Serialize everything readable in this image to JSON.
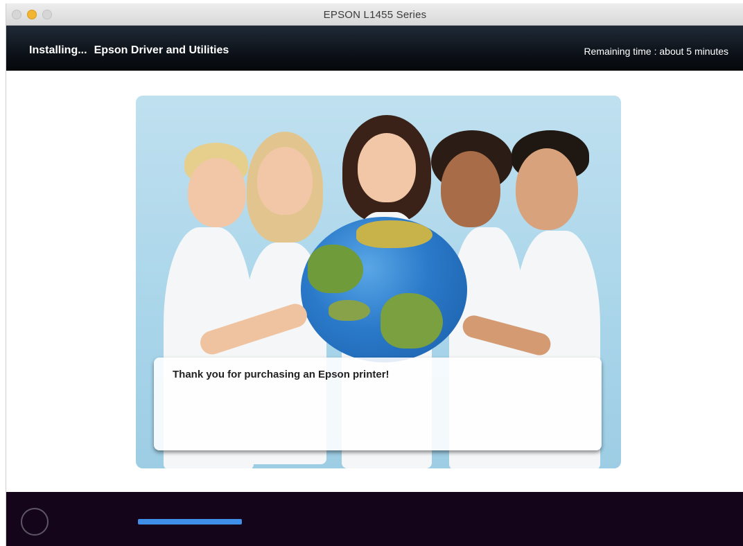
{
  "window": {
    "title": "EPSON L1455 Series"
  },
  "header": {
    "status_label": "Installing...",
    "component": "Epson Driver and Utilities",
    "remaining_time": "Remaining time : about 5 minutes"
  },
  "main": {
    "hero_image": "children-holding-globe",
    "message": "Thank you for purchasing an Epson printer!"
  },
  "footer": {
    "spinner_icon": "activity-spinner-icon",
    "progress_fraction": 0.25
  },
  "colors": {
    "header_bg": "#0b0f15",
    "footer_bg": "#14051a",
    "progress": "#3f8ee8",
    "hero_bg": "#a9d5ea"
  }
}
